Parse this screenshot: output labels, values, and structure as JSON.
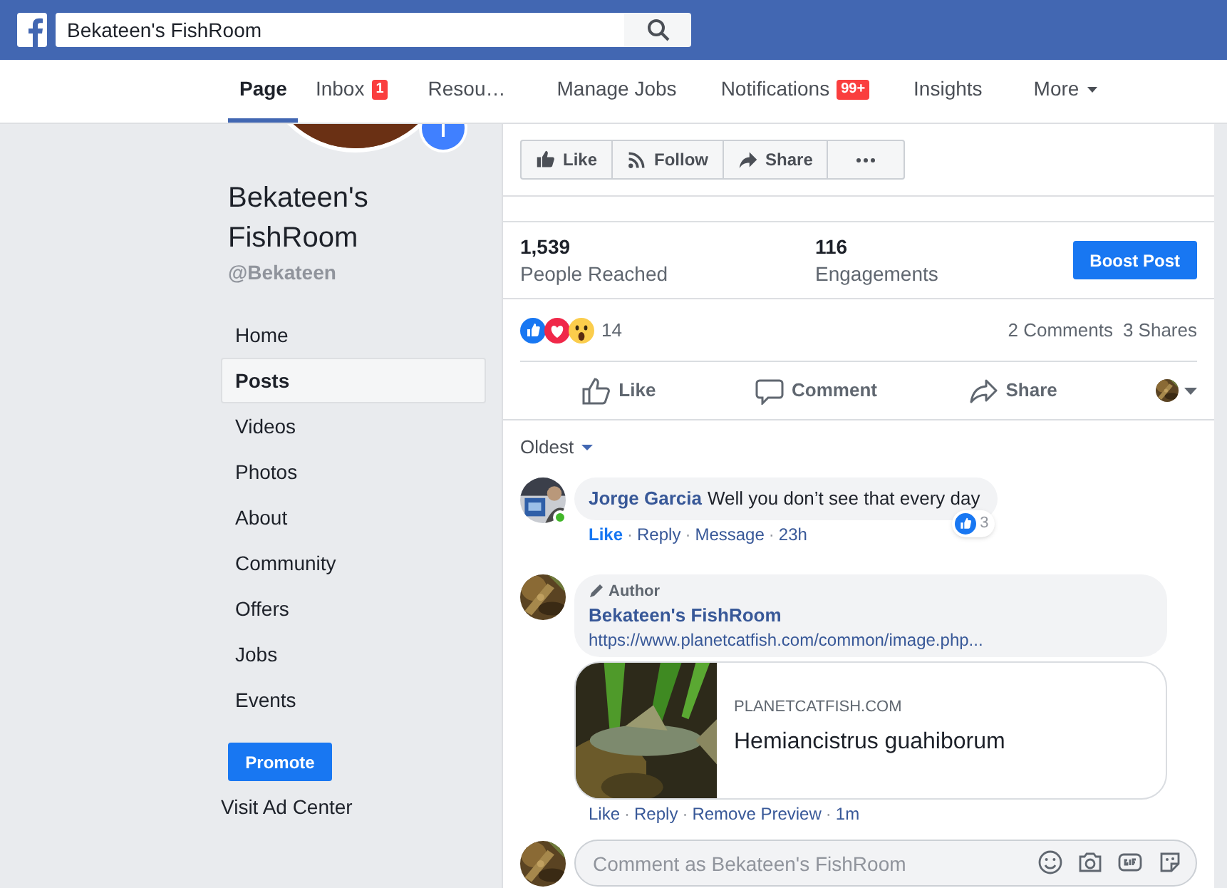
{
  "search": {
    "value": "Bekateen's FishRoom"
  },
  "tabs": [
    {
      "label": "Page",
      "selected": true
    },
    {
      "label": "Inbox",
      "badge": "1",
      "selected": false
    },
    {
      "label": "Resou…",
      "selected": false
    },
    {
      "label": "Manage Jobs",
      "selected": false
    },
    {
      "label": "Notifications",
      "badge": "99+",
      "selected": false
    },
    {
      "label": "Insights",
      "selected": false
    },
    {
      "label": "More",
      "dropdown": true,
      "selected": false
    }
  ],
  "page": {
    "name": "Bekateen's FishRoom",
    "handle": "@Bekateen"
  },
  "sidebar": {
    "items": [
      {
        "label": "Home",
        "selected": false
      },
      {
        "label": "Posts",
        "selected": true
      },
      {
        "label": "Videos",
        "selected": false
      },
      {
        "label": "Photos",
        "selected": false
      },
      {
        "label": "About",
        "selected": false
      },
      {
        "label": "Community",
        "selected": false
      },
      {
        "label": "Offers",
        "selected": false
      },
      {
        "label": "Jobs",
        "selected": false
      },
      {
        "label": "Events",
        "selected": false
      }
    ],
    "promote_button": "Promote",
    "ad_center_link": "Visit Ad Center"
  },
  "page_actions": [
    {
      "kind": "like",
      "label": "Like"
    },
    {
      "kind": "follow",
      "label": "Follow"
    },
    {
      "kind": "share",
      "label": "Share"
    },
    {
      "kind": "more"
    }
  ],
  "stats": [
    {
      "value": "1,539",
      "label": "People Reached"
    },
    {
      "value": "116",
      "label": "Engagements"
    }
  ],
  "boost_button": "Boost Post",
  "reactions": {
    "icons": [
      {
        "kind": "like"
      },
      {
        "kind": "love"
      },
      {
        "kind": "wow"
      }
    ],
    "count": "14"
  },
  "counts": [
    "2 Comments",
    "3 Shares"
  ],
  "post_actions": [
    {
      "kind": "like",
      "label": "Like"
    },
    {
      "kind": "comment",
      "label": "Comment"
    },
    {
      "kind": "share",
      "label": "Share"
    }
  ],
  "sort": "Oldest",
  "comments": [
    {
      "author": "Jorge Garcia",
      "text": "Well you don’t see that every day",
      "online": true,
      "liked": true,
      "reaction_count": "3",
      "actions": [
        "Like",
        "·",
        "Reply",
        "·",
        "Message",
        "·"
      ],
      "time": "23h"
    },
    {
      "author": "Bekateen's FishRoom",
      "badge": "Author",
      "text": "https://www.planetcatfish.com/common/image.php...",
      "online": false,
      "liked": false,
      "preview": {
        "site": "PLANETCATFISH.COM",
        "title": "Hemiancistrus guahiborum"
      },
      "actions": [
        "Like",
        "·",
        "Reply",
        "·",
        "Remove Preview",
        "·"
      ],
      "time": "1m"
    }
  ],
  "composer": {
    "placeholder": "Comment as Bekateen's FishRoom"
  }
}
